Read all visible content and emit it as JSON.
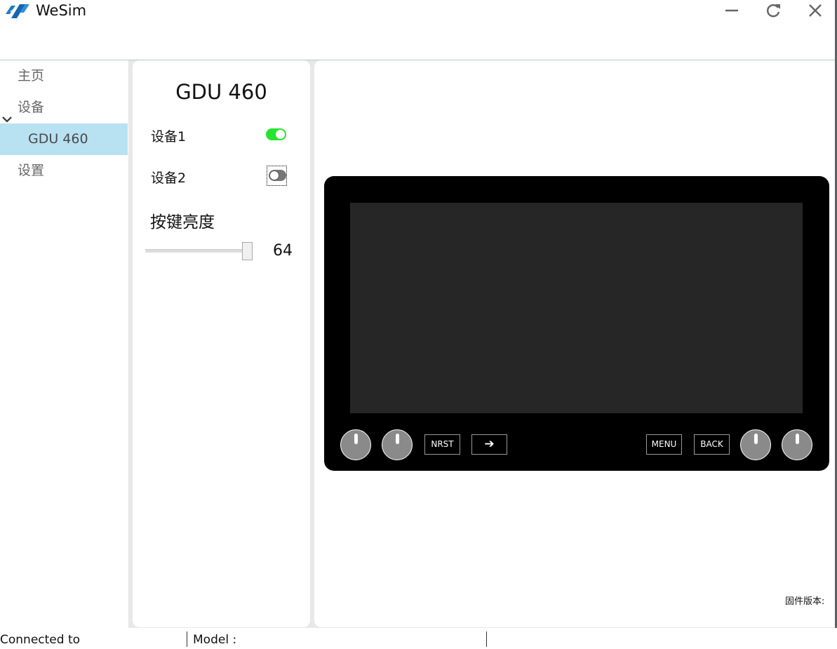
{
  "window": {
    "title": "WeSim",
    "controls": [
      "minimize-icon",
      "refresh-icon",
      "close-icon"
    ]
  },
  "sidebar": {
    "items": [
      {
        "label": "主页"
      },
      {
        "label": "设备",
        "expanded": true
      },
      {
        "label": "GDU 460",
        "selected": true
      },
      {
        "label": "设置"
      }
    ]
  },
  "settings_panel": {
    "title": "GDU 460",
    "device1": {
      "label": "设备1",
      "on": true
    },
    "device2": {
      "label": "设备2",
      "on": false
    },
    "brightness": {
      "label": "按键亮度",
      "value": "64"
    }
  },
  "device": {
    "buttons": {
      "nrst": "NRST",
      "arrow": "➔",
      "menu": "MENU",
      "back": "BACK"
    },
    "firmware_label": "固件版本:"
  },
  "statusbar": {
    "connected": "Connected to",
    "model": "Model :"
  },
  "colors": {
    "accent_selected": "#b8e1f2",
    "toggle_on": "#27e42f",
    "device_body": "#000000",
    "device_screen": "#262626",
    "knob": "#8a8a8a"
  }
}
